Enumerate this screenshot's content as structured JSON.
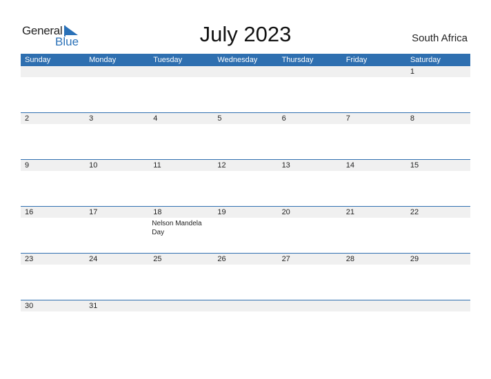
{
  "logo": {
    "word1": "General",
    "word2": "Blue",
    "icon": "triangle-flag-icon",
    "accent": "#2a71b8"
  },
  "title": "July 2023",
  "country": "South Africa",
  "colors": {
    "header_bg": "#2e6fb0",
    "band_bg": "#f0f0f0"
  },
  "weekdays": [
    "Sunday",
    "Monday",
    "Tuesday",
    "Wednesday",
    "Thursday",
    "Friday",
    "Saturday"
  ],
  "weeks": [
    [
      {
        "day": ""
      },
      {
        "day": ""
      },
      {
        "day": ""
      },
      {
        "day": ""
      },
      {
        "day": ""
      },
      {
        "day": ""
      },
      {
        "day": "1"
      }
    ],
    [
      {
        "day": "2"
      },
      {
        "day": "3"
      },
      {
        "day": "4"
      },
      {
        "day": "5"
      },
      {
        "day": "6"
      },
      {
        "day": "7"
      },
      {
        "day": "8"
      }
    ],
    [
      {
        "day": "9"
      },
      {
        "day": "10"
      },
      {
        "day": "11"
      },
      {
        "day": "12"
      },
      {
        "day": "13"
      },
      {
        "day": "14"
      },
      {
        "day": "15"
      }
    ],
    [
      {
        "day": "16"
      },
      {
        "day": "17"
      },
      {
        "day": "18",
        "holiday": "Nelson Mandela Day"
      },
      {
        "day": "19"
      },
      {
        "day": "20"
      },
      {
        "day": "21"
      },
      {
        "day": "22"
      }
    ],
    [
      {
        "day": "23"
      },
      {
        "day": "24"
      },
      {
        "day": "25"
      },
      {
        "day": "26"
      },
      {
        "day": "27"
      },
      {
        "day": "28"
      },
      {
        "day": "29"
      }
    ],
    [
      {
        "day": "30"
      },
      {
        "day": "31"
      },
      {
        "day": ""
      },
      {
        "day": ""
      },
      {
        "day": ""
      },
      {
        "day": ""
      },
      {
        "day": ""
      }
    ]
  ]
}
